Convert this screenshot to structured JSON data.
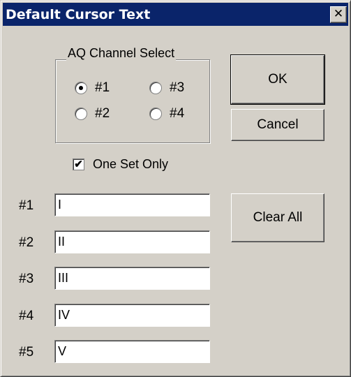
{
  "window": {
    "title": "Default Cursor Text",
    "close_glyph": "✕"
  },
  "channel_group": {
    "label": "AQ Channel Select",
    "options": [
      "#1",
      "#3",
      "#2",
      "#4"
    ],
    "selected": "#1"
  },
  "one_set_only": {
    "label": "One Set Only",
    "checked": true
  },
  "buttons": {
    "ok": "OK",
    "cancel": "Cancel",
    "clear_all": "Clear All"
  },
  "fields": [
    {
      "label": "#1",
      "value": "I"
    },
    {
      "label": "#2",
      "value": "II"
    },
    {
      "label": "#3",
      "value": "III"
    },
    {
      "label": "#4",
      "value": "IV"
    },
    {
      "label": "#5",
      "value": "V"
    }
  ],
  "colors": {
    "titlebar": "#0a246a",
    "face": "#d4d0c8"
  }
}
